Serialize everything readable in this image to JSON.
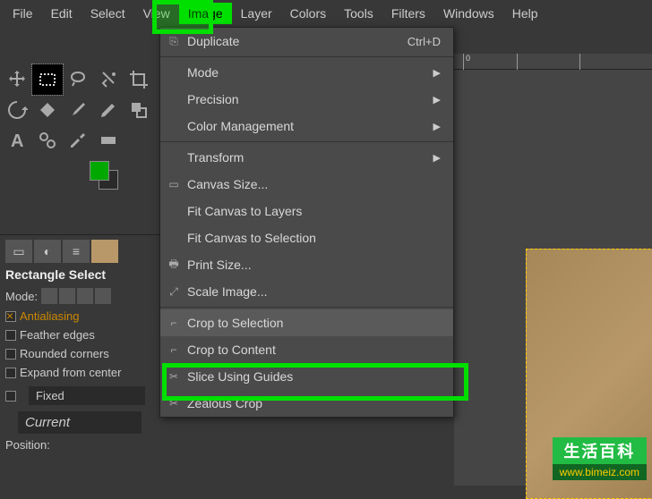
{
  "menubar": [
    "File",
    "Edit",
    "Select",
    "View",
    "Image",
    "Layer",
    "Colors",
    "Tools",
    "Filters",
    "Windows",
    "Help"
  ],
  "menubar_active_index": 4,
  "dropdown": {
    "groups": [
      [
        {
          "icon": "⎘",
          "label": "Duplicate",
          "shortcut": "Ctrl+D"
        }
      ],
      [
        {
          "icon": "",
          "label": "Mode",
          "submenu": true
        },
        {
          "icon": "",
          "label": "Precision",
          "submenu": true
        },
        {
          "icon": "",
          "label": "Color Management",
          "submenu": true
        }
      ],
      [
        {
          "icon": "",
          "label": "Transform",
          "submenu": true
        },
        {
          "icon": "▭",
          "label": "Canvas Size..."
        },
        {
          "icon": "",
          "label": "Fit Canvas to Layers"
        },
        {
          "icon": "",
          "label": "Fit Canvas to Selection"
        },
        {
          "icon": "🖶",
          "label": "Print Size..."
        },
        {
          "icon": "⤢",
          "label": "Scale Image..."
        }
      ],
      [
        {
          "icon": "⌐",
          "label": "Crop to Selection",
          "hover": true
        },
        {
          "icon": "⌐",
          "label": "Crop to Content"
        },
        {
          "icon": "✂",
          "label": "Slice Using Guides"
        },
        {
          "icon": "✂",
          "label": "Zealous Crop"
        }
      ]
    ]
  },
  "toolbox": {
    "tools": [
      "move",
      "rect-select",
      "lasso",
      "fuzzy",
      "crop",
      "rotate",
      "paint",
      "clone",
      "pencil",
      "brush",
      "text",
      "measure",
      "picker",
      "bucket"
    ],
    "active_index": 1,
    "fg_color": "#00a800",
    "bg_color": "#2a2a2a"
  },
  "tool_options": {
    "title": "Rectangle Select",
    "mode_label": "Mode:",
    "antialiasing": "Antialiasing",
    "feather": "Feather edges",
    "rounded": "Rounded corners",
    "expand": "Expand from center",
    "fixed": "Fixed",
    "current": "Current",
    "position": "Position:"
  },
  "ruler": {
    "ticks": [
      {
        "pos": 10,
        "label": "0"
      },
      {
        "pos": 70,
        "label": ""
      },
      {
        "pos": 140,
        "label": ""
      }
    ]
  },
  "watermark": {
    "top": "生活百科",
    "bottom": "www.bimeiz.com"
  }
}
